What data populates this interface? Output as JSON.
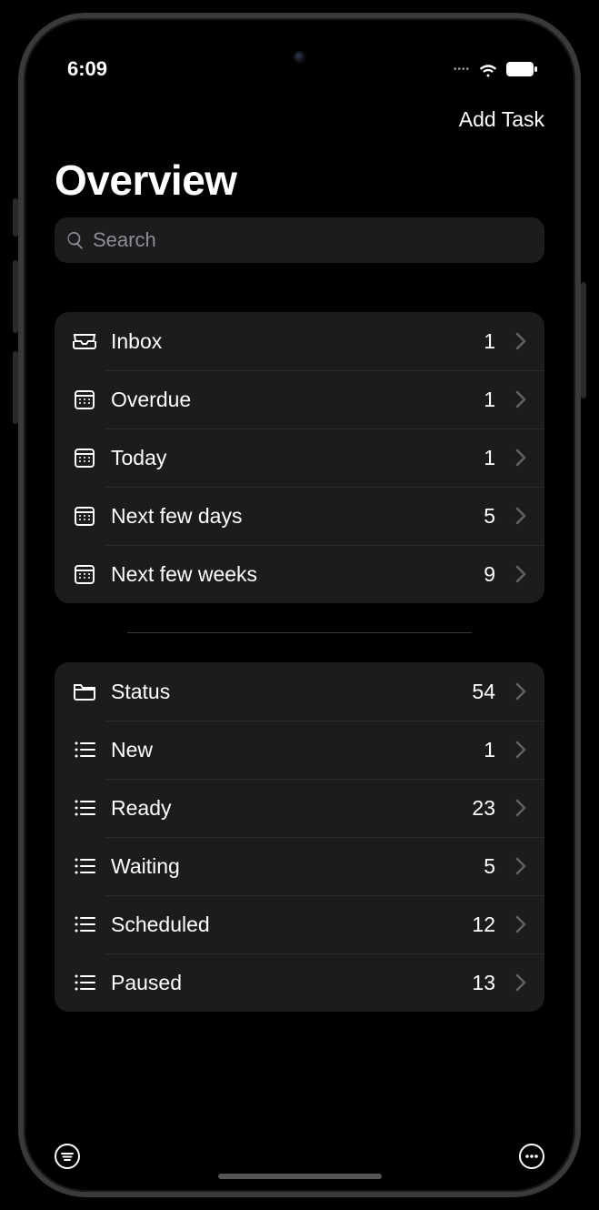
{
  "status_bar": {
    "time": "6:09"
  },
  "nav": {
    "add_task": "Add Task"
  },
  "title": "Overview",
  "search": {
    "placeholder": "Search"
  },
  "groups": [
    {
      "rows": [
        {
          "icon": "inbox",
          "label": "Inbox",
          "count": "1"
        },
        {
          "icon": "calendar",
          "label": "Overdue",
          "count": "1"
        },
        {
          "icon": "calendar",
          "label": "Today",
          "count": "1"
        },
        {
          "icon": "calendar",
          "label": "Next few days",
          "count": "5"
        },
        {
          "icon": "calendar",
          "label": "Next few weeks",
          "count": "9"
        }
      ]
    },
    {
      "rows": [
        {
          "icon": "folder",
          "label": "Status",
          "count": "54"
        },
        {
          "icon": "list",
          "label": "New",
          "count": "1"
        },
        {
          "icon": "list",
          "label": "Ready",
          "count": "23"
        },
        {
          "icon": "list",
          "label": "Waiting",
          "count": "5"
        },
        {
          "icon": "list",
          "label": "Scheduled",
          "count": "12"
        },
        {
          "icon": "list",
          "label": "Paused",
          "count": "13"
        }
      ]
    }
  ]
}
